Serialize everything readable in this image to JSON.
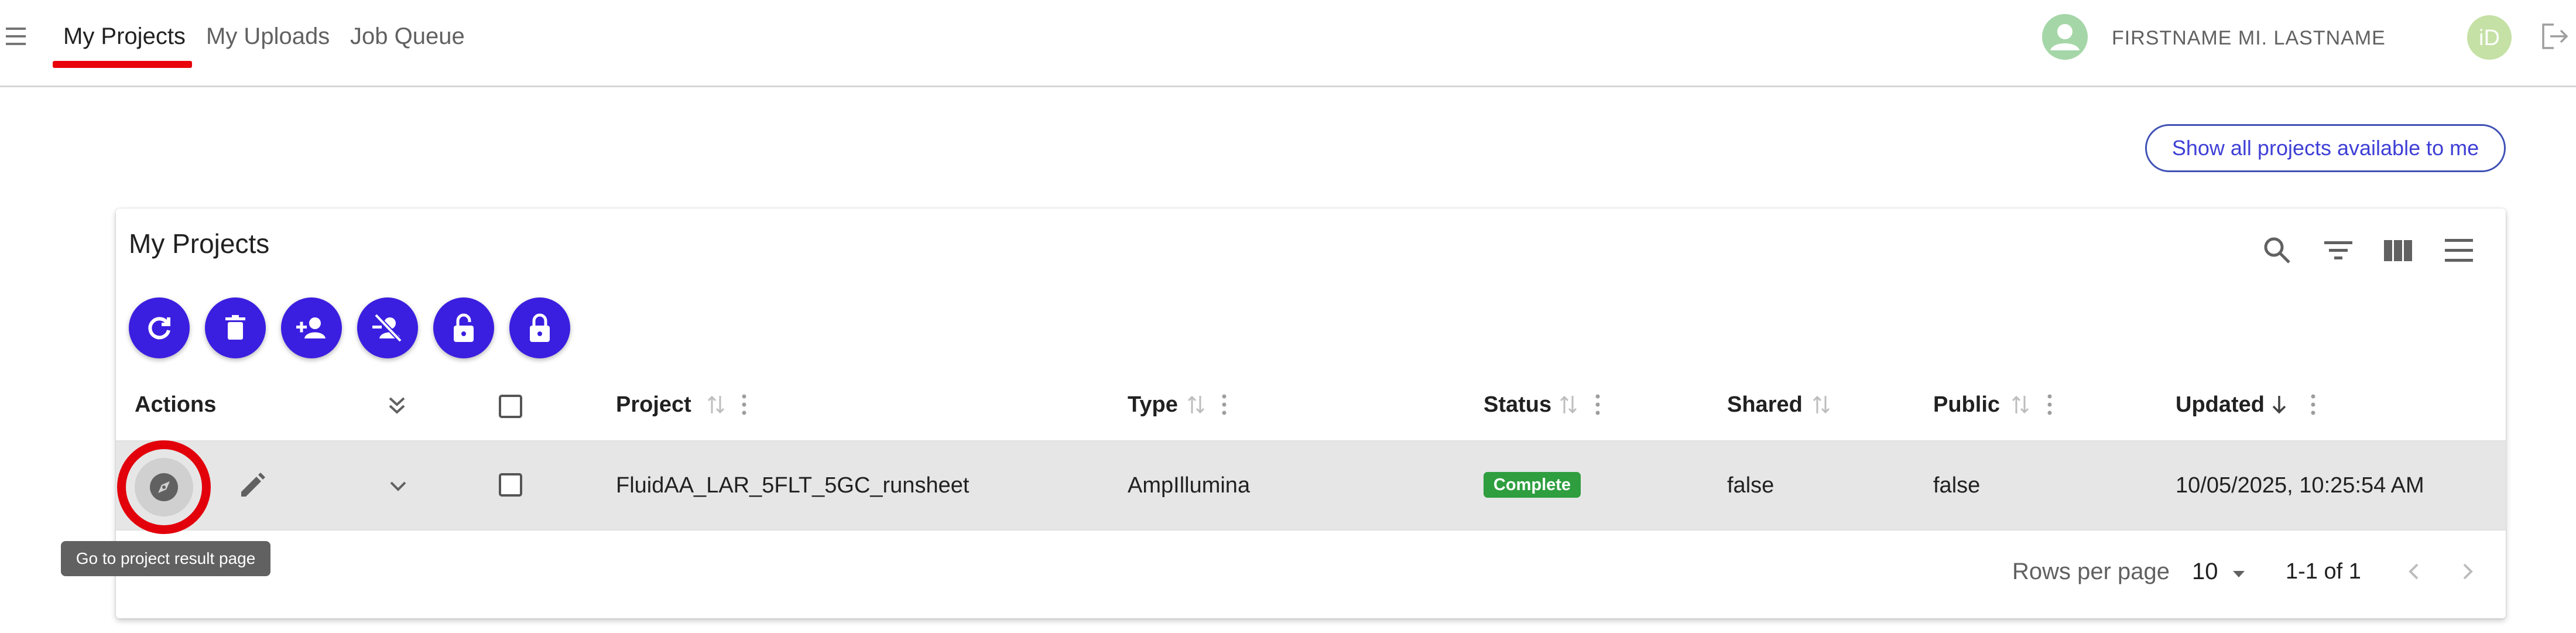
{
  "nav": {
    "tabs": [
      {
        "label": "My Projects",
        "active": true
      },
      {
        "label": "My Uploads",
        "active": false
      },
      {
        "label": "Job Queue",
        "active": false
      }
    ]
  },
  "user": {
    "name": "FIRSTNAME MI. LASTNAME",
    "orcid_text": "iD"
  },
  "show_all_button": "Show all projects available to me",
  "card": {
    "title": "My Projects",
    "toolbar_icons": [
      "search-icon",
      "filter-icon",
      "view-columns-icon",
      "menu-icon"
    ]
  },
  "action_buttons": [
    "refresh-icon",
    "delete-icon",
    "add-user-icon",
    "remove-user-icon",
    "lock-open-icon",
    "lock-icon"
  ],
  "table": {
    "headers": {
      "actions": "Actions",
      "project": "Project",
      "type": "Type",
      "status": "Status",
      "shared": "Shared",
      "public": "Public",
      "updated": "Updated"
    },
    "rows": [
      {
        "project": "FluidAA_LAR_5FLT_5GC_runsheet",
        "type": "AmpIllumina",
        "status": "Complete",
        "shared": "false",
        "public": "false",
        "updated": "10/05/2025, 10:25:54 AM"
      }
    ]
  },
  "tooltip": "Go to project result page",
  "pagination": {
    "rows_per_page_label": "Rows per page",
    "rows_per_page": "10",
    "range": "1-1 of 1"
  },
  "colors": {
    "accent": "#3a1fe0",
    "highlight": "#e2000b",
    "status_complete": "#2e9e3f",
    "orcid": "#a6ce39"
  }
}
